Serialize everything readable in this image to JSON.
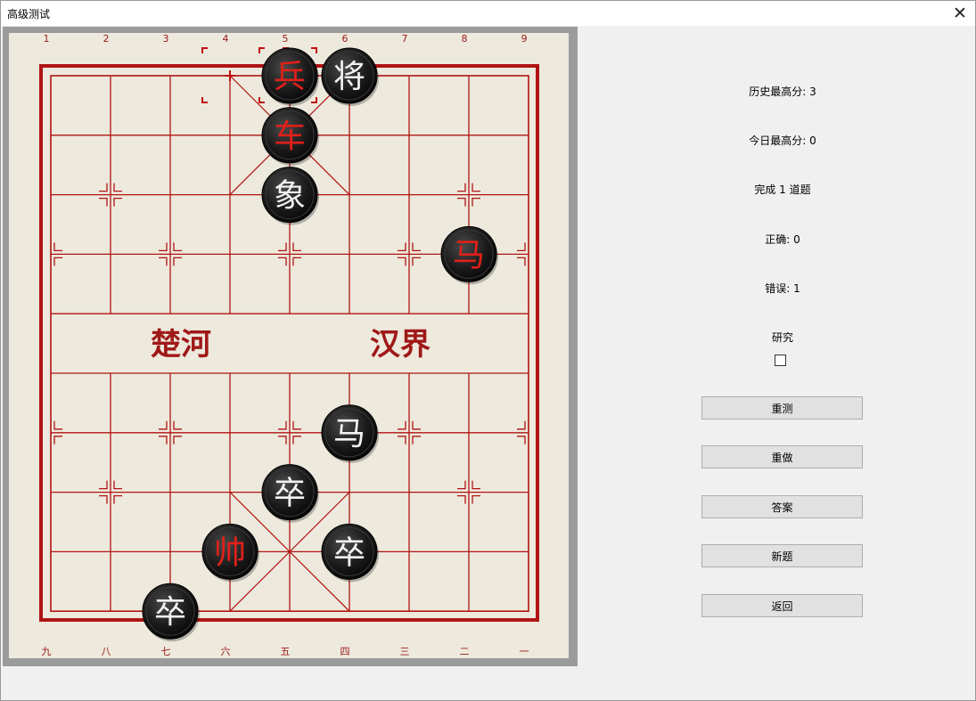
{
  "window": {
    "title": "高级测试",
    "close_glyph": "✕"
  },
  "board": {
    "top_numbers": [
      "1",
      "2",
      "3",
      "4",
      "5",
      "6",
      "7",
      "8",
      "9"
    ],
    "bottom_numbers": [
      "九",
      "八",
      "七",
      "六",
      "五",
      "四",
      "三",
      "二",
      "一"
    ],
    "river_left": "楚河",
    "river_right": "汉界",
    "colors": {
      "background": "#ede9dc",
      "lines": "#b01414",
      "red_text": "#e0201a",
      "black_text": "#f2f2f2",
      "piece": "#141414"
    },
    "pieces": [
      {
        "name": "兵",
        "side": "red",
        "col": 5,
        "row": 0
      },
      {
        "name": "将",
        "side": "black",
        "col": 6,
        "row": 0
      },
      {
        "name": "车",
        "side": "red",
        "col": 5,
        "row": 1
      },
      {
        "name": "象",
        "side": "black",
        "col": 5,
        "row": 2
      },
      {
        "name": "马",
        "side": "red",
        "col": 8,
        "row": 3
      },
      {
        "name": "马",
        "side": "black",
        "col": 6,
        "row": 6
      },
      {
        "name": "卒",
        "side": "black",
        "col": 5,
        "row": 7
      },
      {
        "name": "帅",
        "side": "red",
        "col": 4,
        "row": 8
      },
      {
        "name": "卒",
        "side": "black",
        "col": 6,
        "row": 8
      },
      {
        "name": "卒",
        "side": "black",
        "col": 3,
        "row": 9
      }
    ]
  },
  "panel": {
    "history_best": "历史最高分: 3",
    "today_best": "今日最高分: 0",
    "completed": "完成 1 道题",
    "correct": "正确: 0",
    "wrong": "错误: 1",
    "research_label": "研究",
    "research_checked": false
  },
  "buttons": {
    "retest": "重测",
    "redo": "重做",
    "answer": "答案",
    "new_problem": "新题",
    "back": "返回"
  }
}
